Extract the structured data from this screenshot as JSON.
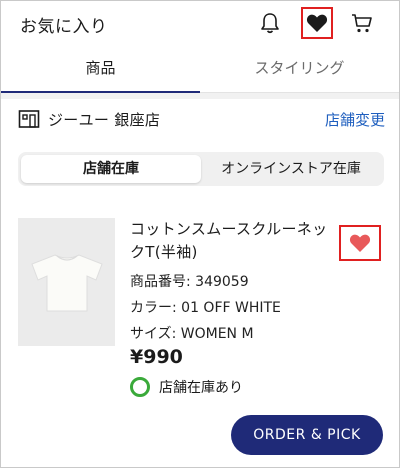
{
  "header": {
    "title": "お気に入り",
    "icons": [
      "bell-icon",
      "heart-icon",
      "cart-icon"
    ]
  },
  "tabs": [
    {
      "label": "商品",
      "active": true
    },
    {
      "label": "スタイリング",
      "active": false
    }
  ],
  "store": {
    "name": "ジーユー 銀座店",
    "change_label": "店舗変更",
    "icon": "store-icon"
  },
  "segment": [
    {
      "label": "店舗在庫",
      "active": true
    },
    {
      "label": "オンラインストア在庫",
      "active": false
    }
  ],
  "product": {
    "name": "コットンスムースクルーネックT(半袖)",
    "number": "商品番号: 349059",
    "color": "カラー: 01 OFF WHITE",
    "size": "サイズ: WOMEN M",
    "price": "¥990",
    "stock": "店舗在庫あり"
  },
  "cta": {
    "label": "ORDER & PICK"
  },
  "colors": {
    "accent": "#1f2a78",
    "link": "#1f5fbf",
    "favorite": "#e8595a",
    "stock_ok": "#3aaa3a",
    "highlight_box": "#e02020"
  }
}
